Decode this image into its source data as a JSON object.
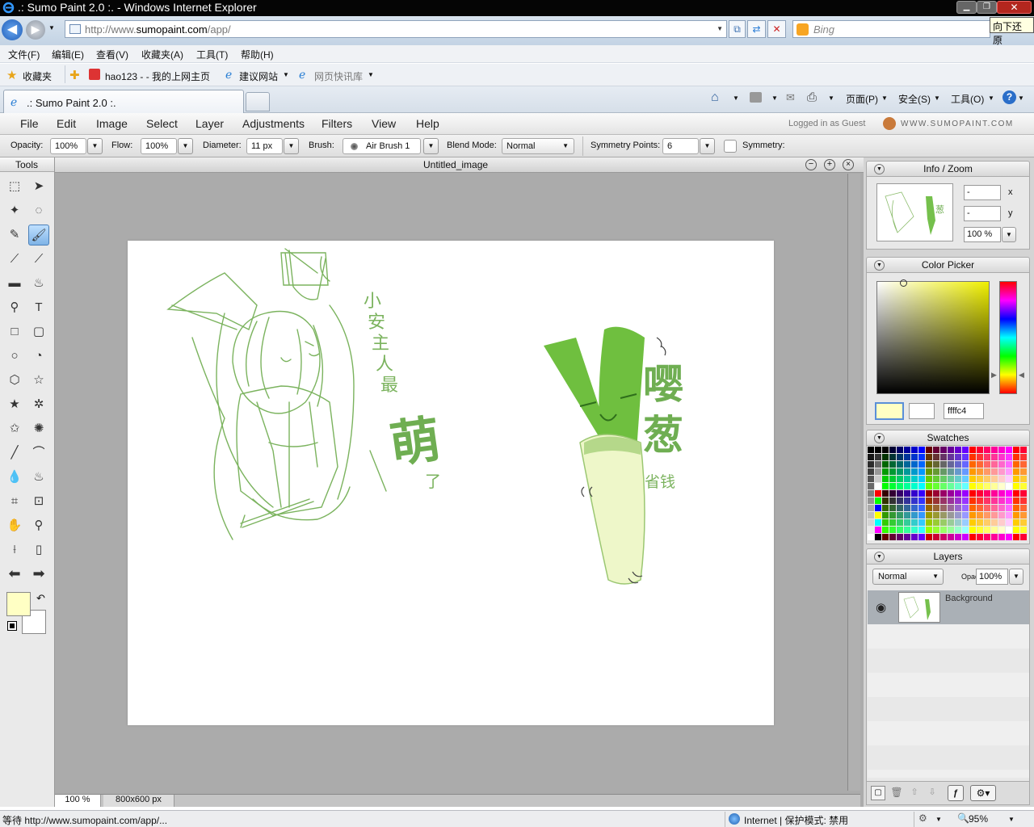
{
  "browser": {
    "title": ".: Sumo Paint 2.0 :. - Windows Internet Explorer",
    "restore_tooltip": "向下还原",
    "address_prefix": "http://www.",
    "address_domain": "sumopaint.com",
    "address_suffix": "/app/",
    "search_placeholder": "Bing",
    "menu": [
      "文件(F)",
      "编辑(E)",
      "查看(V)",
      "收藏夹(A)",
      "工具(T)",
      "帮助(H)"
    ],
    "favorites": {
      "label": "收藏夹",
      "hao123": "hao123 -   - 我的上网主页",
      "suggested": "建议网站",
      "slices": "网页快讯库"
    },
    "tab_title": ".: Sumo Paint 2.0 :.",
    "commands": {
      "page": "页面(P)",
      "safety": "安全(S)",
      "tools": "工具(O)"
    },
    "status": {
      "text": "等待 http://www.sumopaint.com/app/...",
      "zone": "Internet | 保护模式: 禁用",
      "zoom": "95%"
    }
  },
  "app": {
    "menu": [
      "File",
      "Edit",
      "Image",
      "Select",
      "Layer",
      "Adjustments",
      "Filters",
      "View",
      "Help"
    ],
    "logged_in": "Logged in as Guest",
    "brand": "WWW.SUMOPAINT.COM",
    "options": {
      "opacity_label": "Opacity:",
      "opacity": "100%",
      "flow_label": "Flow:",
      "flow": "100%",
      "diameter_label": "Diameter:",
      "diameter": "11 px",
      "brush_label": "Brush:",
      "brush": "Air Brush 1",
      "blend_label": "Blend Mode:",
      "blend": "Normal",
      "sym_points_label": "Symmetry Points:",
      "sym_points": "6",
      "symmetry_label": "Symmetry:"
    },
    "tools_title": "Tools",
    "document": {
      "title": "Untitled_image",
      "zoom": "100 %",
      "size": "800x600 px"
    },
    "info_zoom": {
      "title": "Info / Zoom",
      "x_value": "-",
      "y_value": "-",
      "x_label": "x",
      "y_label": "y",
      "zoom": "100 %"
    },
    "color_picker": {
      "title": "Color Picker",
      "hex": "ffffc4",
      "foreground": "#ffffc4",
      "background": "#ffffff"
    },
    "swatches_title": "Swatches",
    "layers": {
      "title": "Layers",
      "blend": "Normal",
      "opacity_label": "Opacity:",
      "opacity": "100%",
      "layer_name": "Background"
    }
  },
  "artwork": {
    "left_text": [
      "小",
      "安",
      "主",
      "人",
      "最"
    ],
    "big_char": "萌",
    "suffix": "了",
    "right_chars": [
      "嘤",
      "葱"
    ],
    "small_text": "省钱",
    "color": "#6fae52"
  }
}
